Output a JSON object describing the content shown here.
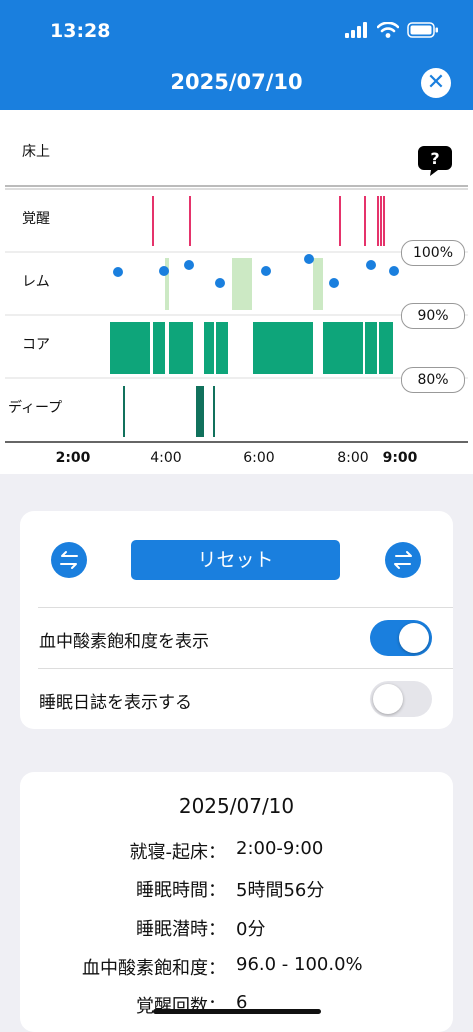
{
  "status_bar": {
    "time": "13:28",
    "icons": [
      "signal-icon",
      "wifi-icon",
      "battery-icon"
    ]
  },
  "header": {
    "title": "2025/07/10",
    "close_icon": "close-icon",
    "accent": "#1a7fde"
  },
  "chart": {
    "rows": [
      "床上",
      "覚醒",
      "レム",
      "コア",
      "ディープ"
    ],
    "help_icon": "question-icon",
    "x_ticks": [
      {
        "label": "2:00",
        "bold": true
      },
      {
        "label": "4:00",
        "bold": false
      },
      {
        "label": "6:00",
        "bold": false
      },
      {
        "label": "8:00",
        "bold": false
      },
      {
        "label": "9:00",
        "bold": true
      }
    ],
    "spo2_labels": [
      "100%",
      "90%",
      "80%"
    ],
    "colors": {
      "awake": "#e5336b",
      "rem": "#cce9c4",
      "core": "#0ea57a",
      "deep": "#11715c",
      "spo2": "#1a7fde"
    }
  },
  "controls": {
    "reset_label": "リセット",
    "left_icon": "swap-arrows-icon",
    "right_icon": "swap-arrows-icon",
    "options": [
      {
        "label": "血中酸素飽和度を表示",
        "on": true
      },
      {
        "label": "睡眠日誌を表示する",
        "on": false
      }
    ]
  },
  "summary": {
    "title": "2025/07/10",
    "rows": [
      {
        "key": "就寝-起床：",
        "value": "2:00-9:00"
      },
      {
        "key": "睡眠時間：",
        "value": "5時間56分"
      },
      {
        "key": "睡眠潜時：",
        "value": "0分"
      },
      {
        "key": "血中酸素飽和度：",
        "value": "96.0 - 100.0%"
      },
      {
        "key": "覚醒回数：",
        "value": "6"
      }
    ]
  }
}
